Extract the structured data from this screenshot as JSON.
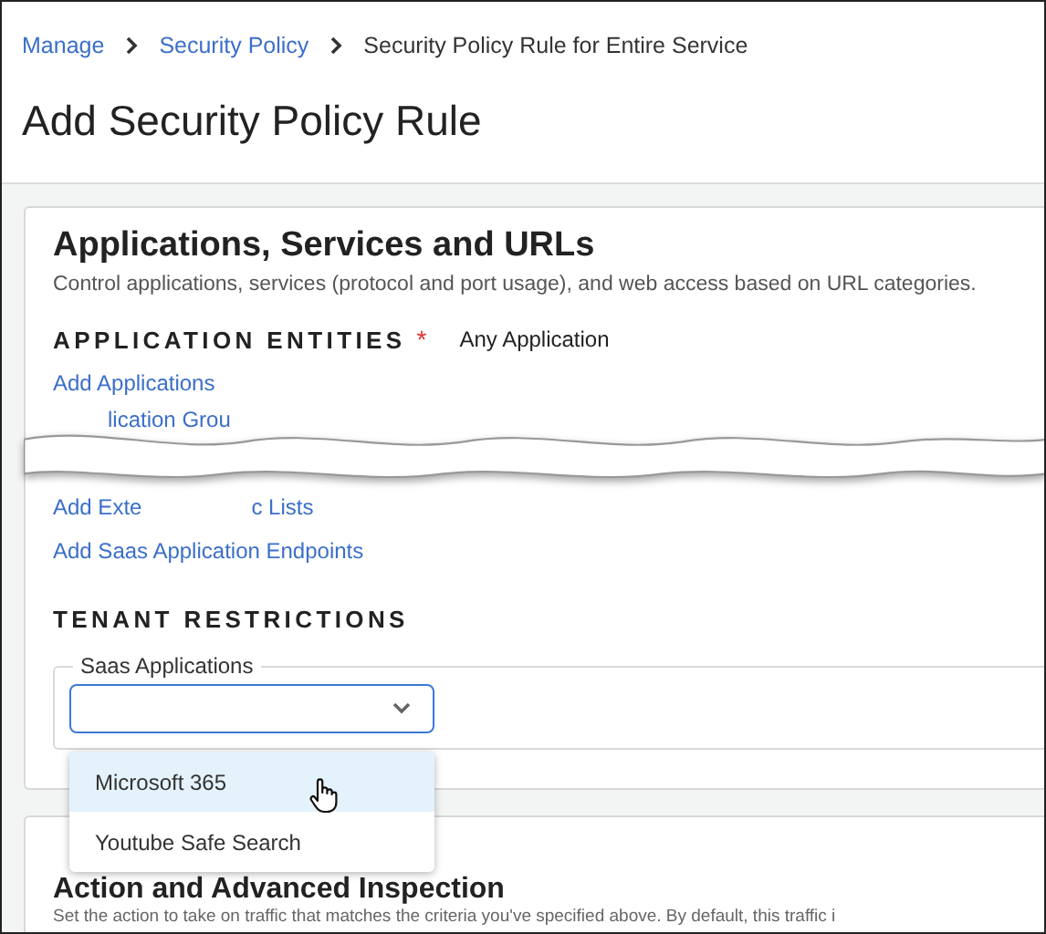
{
  "breadcrumb": [
    {
      "label": "Manage",
      "kind": "link"
    },
    {
      "label": "Security Policy",
      "kind": "link"
    },
    {
      "label": "Security Policy Rule for Entire Service",
      "kind": "current"
    }
  ],
  "page_title": "Add Security Policy Rule",
  "applications_section": {
    "title": "Applications, Services and URLs",
    "description": "Control applications, services (protocol and port usage), and web access based on URL categories.",
    "entities_label": "APPLICATION ENTITIES",
    "required_mark": "*",
    "entities_value": "Any Application",
    "links": [
      {
        "kind": "plain",
        "parts": [
          "Add Applications"
        ]
      },
      {
        "kind": "torn",
        "parts": [
          "lication Grou"
        ]
      },
      {
        "kind": "gapped",
        "parts": [
          "Add Exte",
          "c Lists"
        ]
      },
      {
        "kind": "plain",
        "parts": [
          "Add Saas Application Endpoints"
        ]
      }
    ],
    "tenant_label": "TENANT RESTRICTIONS",
    "saas_field": {
      "label": "Saas Applications",
      "open": true,
      "options": [
        {
          "label": "Microsoft 365",
          "selected": true
        },
        {
          "label": "Youtube Safe Search",
          "selected": false
        }
      ]
    }
  },
  "action_section": {
    "title": "Action and Advanced Inspection",
    "description": "Set the action to take on traffic that matches the criteria you've specified above. By default, this traffic i"
  }
}
